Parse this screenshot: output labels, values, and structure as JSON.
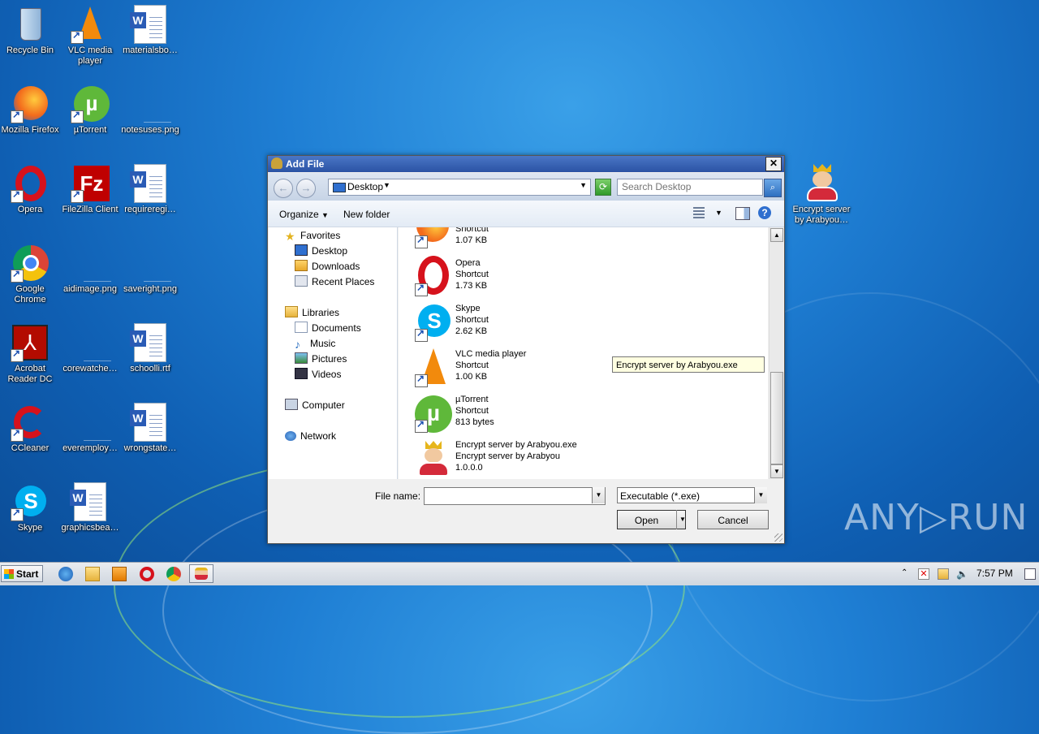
{
  "desktop": {
    "icons": [
      {
        "label": "Recycle Bin"
      },
      {
        "label": "VLC media player"
      },
      {
        "label": "materialsbo…"
      },
      {
        "label": "Mozilla Firefox"
      },
      {
        "label": "µTorrent"
      },
      {
        "label": "notesuses.png"
      },
      {
        "label": "Opera"
      },
      {
        "label": "FileZilla Client"
      },
      {
        "label": "requireregi…"
      },
      {
        "label": "Google Chrome"
      },
      {
        "label": "aidimage.png"
      },
      {
        "label": "saveright.png"
      },
      {
        "label": "Acrobat Reader DC"
      },
      {
        "label": "corewatche…"
      },
      {
        "label": "schoolli.rtf"
      },
      {
        "label": "CCleaner"
      },
      {
        "label": "everemploy…"
      },
      {
        "label": "wrongstate…"
      },
      {
        "label": "Skype"
      },
      {
        "label": "graphicsbea…"
      },
      {
        "label": "Encrypt server by Arabyou…"
      }
    ]
  },
  "dialog": {
    "title": "Add File",
    "close_glyph": "✕",
    "back_glyph": "←",
    "forward_glyph": "→",
    "address": {
      "location": "Desktop"
    },
    "search": {
      "placeholder": "Search Desktop"
    },
    "toolbar": {
      "organize": "Organize",
      "new_folder": "New folder"
    },
    "nav": {
      "favorites": "Favorites",
      "desktop": "Desktop",
      "downloads": "Downloads",
      "recent": "Recent Places",
      "libraries": "Libraries",
      "documents": "Documents",
      "music": "Music",
      "pictures": "Pictures",
      "videos": "Videos",
      "computer": "Computer",
      "network": "Network"
    },
    "files": [
      {
        "name": "",
        "type": "Shortcut",
        "size": "1.07 KB"
      },
      {
        "name": "Opera",
        "type": "Shortcut",
        "size": "1.73 KB"
      },
      {
        "name": "Skype",
        "type": "Shortcut",
        "size": "2.62 KB"
      },
      {
        "name": "VLC media player",
        "type": "Shortcut",
        "size": "1.00 KB"
      },
      {
        "name": "µTorrent",
        "type": "Shortcut",
        "size": "813 bytes"
      },
      {
        "name": "Encrypt server by Arabyou.exe",
        "type": "Encrypt server by Arabyou",
        "size": "1.0.0.0"
      }
    ],
    "tooltip": "Encrypt server by Arabyou.exe",
    "filename_label": "File name:",
    "filename_value": "",
    "filetype": "Executable  (*.exe)",
    "open": "Open",
    "cancel": "Cancel"
  },
  "taskbar": {
    "start": "Start",
    "clock": "7:57 PM"
  },
  "watermark": "ANY▷RUN",
  "colors": {
    "desktop_bg": "#1f7fd4",
    "titlebar": "#2b53a4",
    "tooltip_bg": "#ffffe1"
  }
}
